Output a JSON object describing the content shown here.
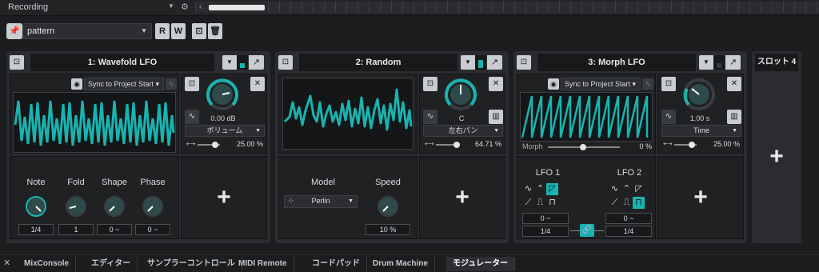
{
  "topbar": {
    "title": "Recording"
  },
  "pattern": {
    "value": "pattern",
    "r_label": "R",
    "w_label": "W"
  },
  "slot1": {
    "title": "1: Wavefold LFO",
    "sync": "Sync to Project Start",
    "gain": "0.00 dB",
    "param": "ボリューム",
    "depth": "25.00 %",
    "params": [
      {
        "label": "Note",
        "value": "1/4"
      },
      {
        "label": "Fold",
        "value": "1"
      },
      {
        "label": "Shape",
        "value": "0 ~"
      },
      {
        "label": "Phase",
        "value": "0 ~"
      }
    ]
  },
  "slot2": {
    "title": "2: Random",
    "key": "C",
    "param": "左右パン",
    "depth": "64.71 %",
    "model_label": "Model",
    "model_value": "Perlin",
    "speed_label": "Speed",
    "speed_value": "10 %"
  },
  "slot3": {
    "title": "3: Morph LFO",
    "sync": "Sync to Project Start",
    "time": "1.00 s",
    "param": "Time",
    "depth": "25.00 %",
    "morph_label": "Morph",
    "morph_value": "0 %",
    "lfo1_label": "LFO 1",
    "lfo2_label": "LFO 2",
    "lfo1_phase": "0 ~",
    "lfo1_rate": "1/4",
    "lfo2_phase": "0 ~",
    "lfo2_rate": "1/4"
  },
  "slot4": {
    "title": "スロット 4"
  },
  "tabs": [
    {
      "label": "MixConsole"
    },
    {
      "label": "エディター"
    },
    {
      "label": "サンプラーコントロール"
    },
    {
      "label": "MIDI Remote"
    },
    {
      "label": "コードパッド"
    },
    {
      "label": "Drum Machine"
    },
    {
      "label": "モジュレーター"
    }
  ],
  "colors": {
    "accent": "#19b3b0",
    "panel": "#2a2c2f",
    "background": "#1b1d1f"
  }
}
